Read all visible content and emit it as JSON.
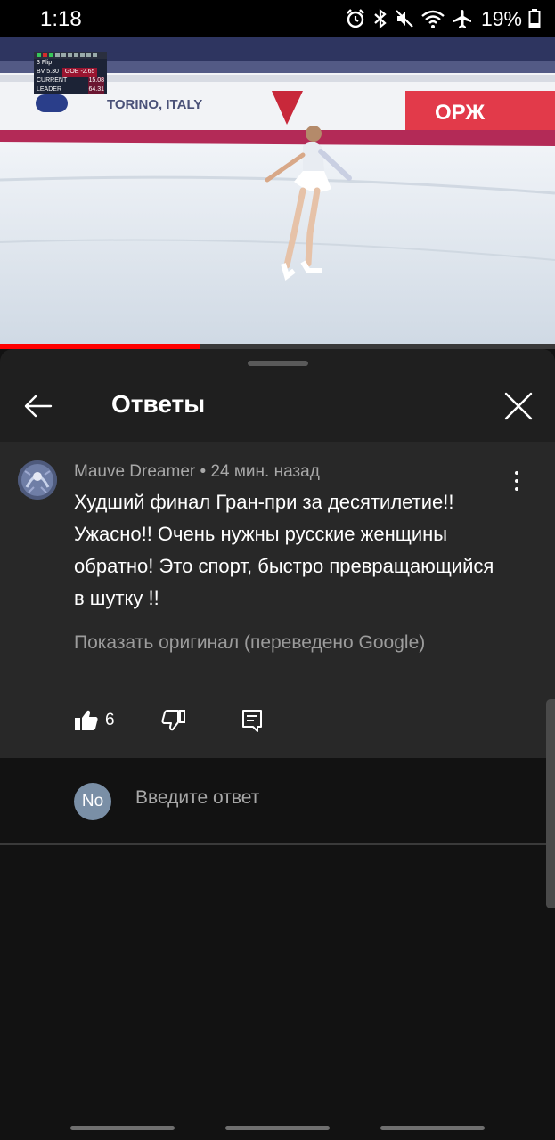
{
  "status_bar": {
    "time": "1:18",
    "battery": "19%",
    "icons": [
      "alarm-icon",
      "bluetooth-icon",
      "mute-icon",
      "wifi-icon",
      "airplane-icon",
      "battery-icon"
    ]
  },
  "video": {
    "scoreboard": {
      "element": "3 Flip",
      "bv_label": "BV",
      "bv_value": "5.30",
      "goe_label": "GOE",
      "goe_value": "-2.65",
      "current_label": "CURRENT",
      "current_value": "15.08",
      "leader_label": "LEADER",
      "leader_value": "64.31"
    },
    "banner_text": "TORINO, ITALY",
    "sponsor_text": "ОРЖ",
    "progress_fraction": 0.36,
    "colors": {
      "progress": "#ff0000"
    }
  },
  "header": {
    "title": "Ответы"
  },
  "comment": {
    "author": "Mauve Dreamer",
    "time": "24 мин. назад",
    "separator": "•",
    "text": "Худший финал Гран-при за десятилетие!! Ужасно!! Очень нужны русские женщины обратно! Это спорт, быстро превращающийся в шутку !!",
    "show_original": "Показать оригинал (переведено Google)",
    "likes": "6"
  },
  "reply": {
    "avatar_initials": "No",
    "placeholder": "Введите ответ"
  }
}
